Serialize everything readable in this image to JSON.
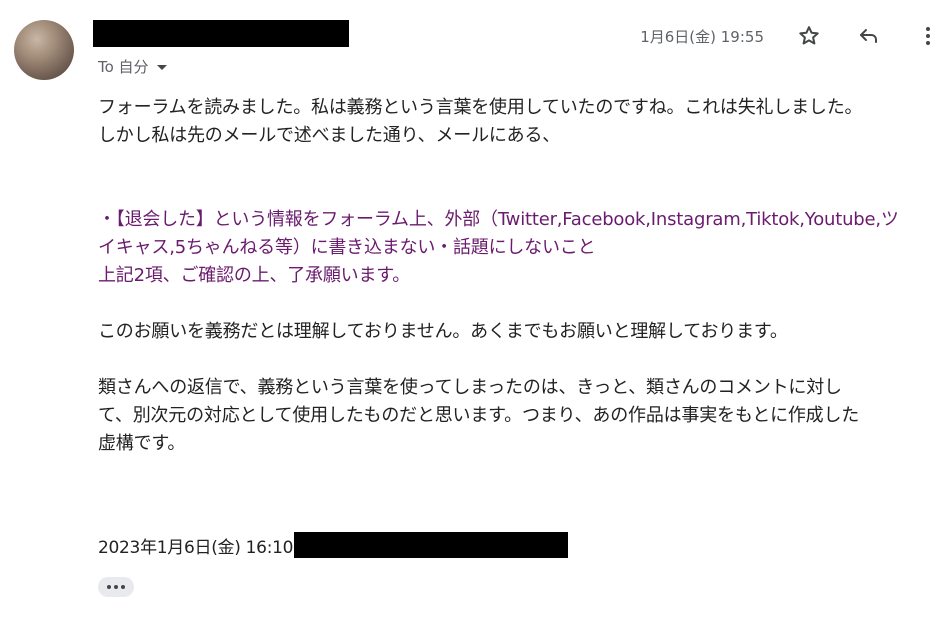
{
  "header": {
    "recipient_label": "To 自分",
    "date": "1月6日(金) 19:55",
    "icons": {
      "star": "star-outline-icon",
      "reply": "reply-icon",
      "more": "more-vertical-icon"
    }
  },
  "message": {
    "line1": "フォーラムを読みました。私は義務という言葉を使用していたのですね。これは失礼しました。",
    "line2": "しかし私は先のメールで述べました通り、メールにある、",
    "quote_line1": "・【退会した】という情報をフォーラム上、外部（Twitter,Facebook,Instagram,Tiktok,Youtube,ツ",
    "quote_line2": "イキャス,5ちゃんねる等）に書き込まない・話題にしないこと",
    "quote_line3": "上記2項、ご確認の上、了承願います。",
    "para2": "このお願いを義務だとは理解しておりません。あくまでもお願いと理解しております。",
    "para3_line1": "類さんへの返信で、義務という言葉を使ってしまったのは、きっと、類さんのコメントに対し",
    "para3_line2": "て、別次元の対応として使用したものだと思います。つまり、あの作品は事実をもとに作成した",
    "para3_line3": "虚構です。",
    "quoted_header_date": "2023年1月6日(金) 16:10"
  },
  "colors": {
    "quote_text": "#6a1b6e",
    "meta_text": "#5f6368",
    "redaction": "#000000"
  }
}
